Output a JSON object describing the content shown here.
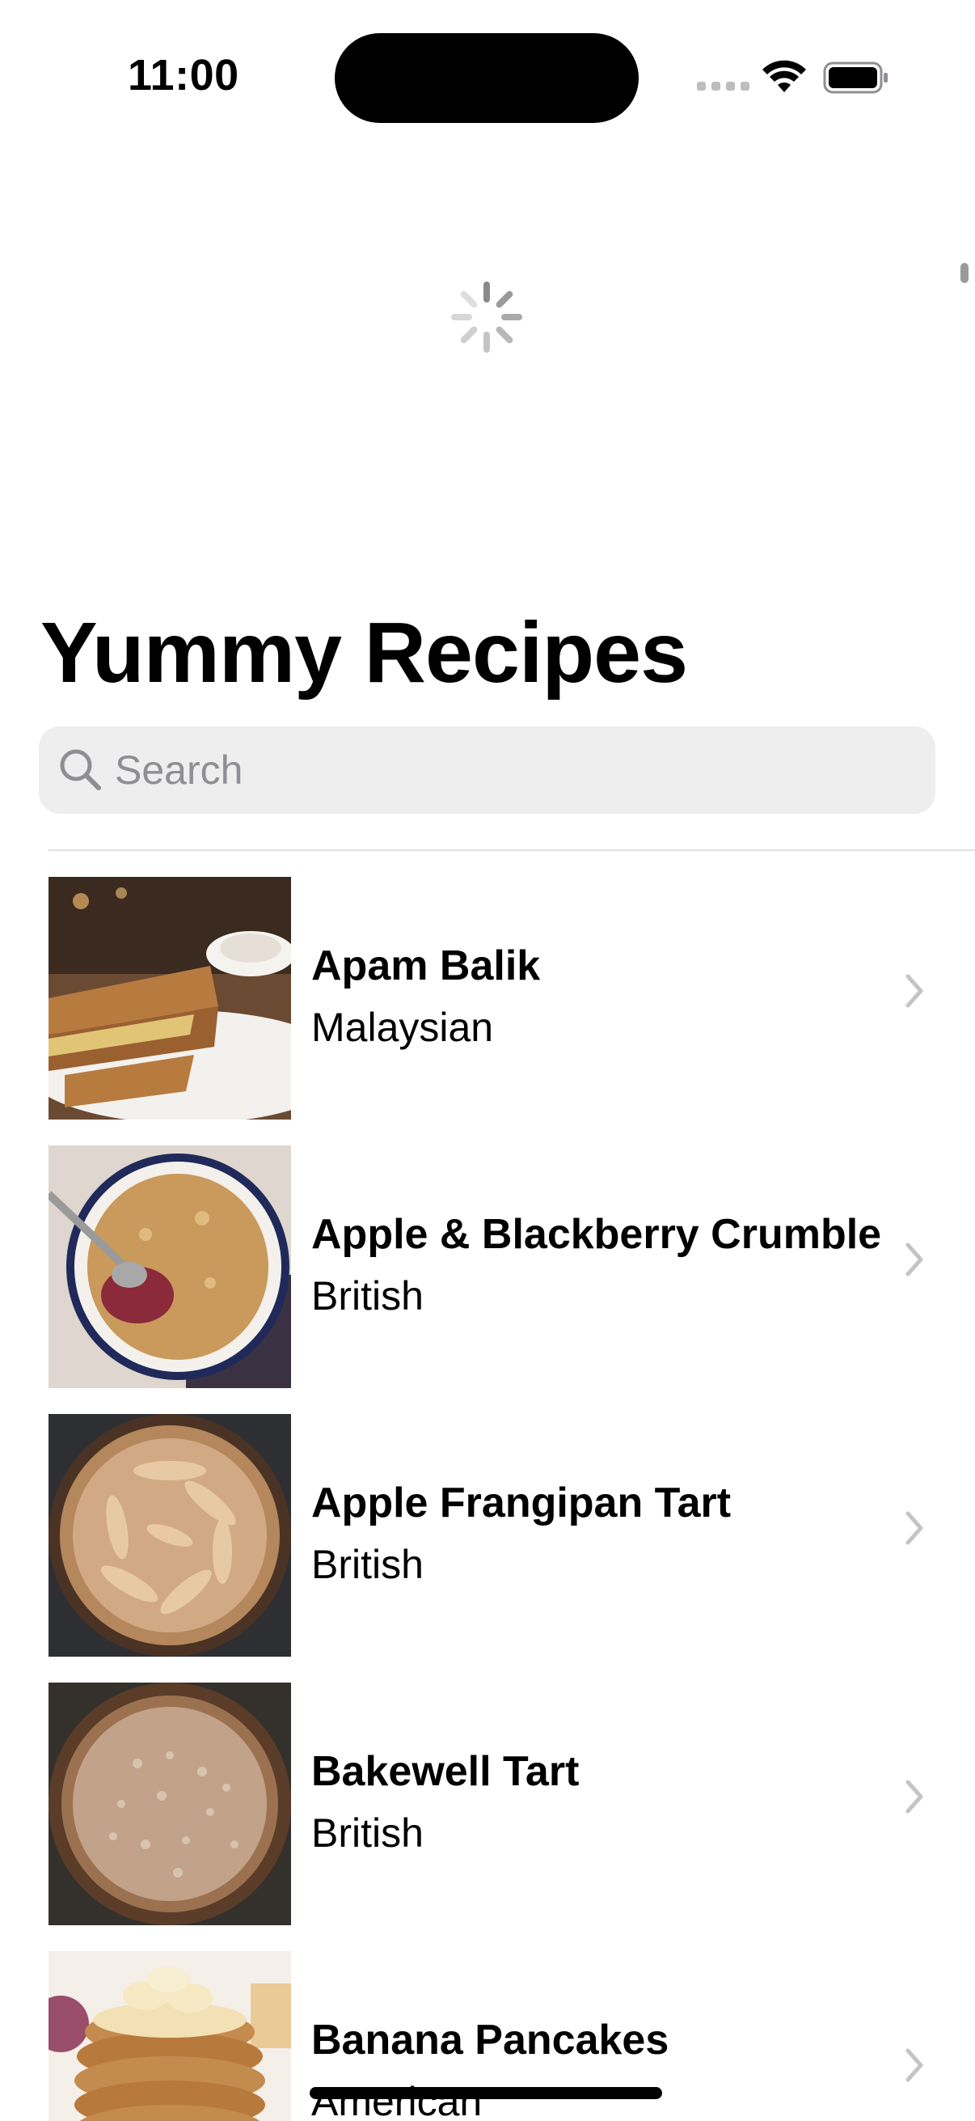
{
  "status_bar": {
    "time": "11:00",
    "icons": [
      "cellular-signal-icon",
      "wifi-icon",
      "battery-icon"
    ]
  },
  "loading_indicator": "activity-spinner-icon",
  "title": "Yummy Recipes",
  "search": {
    "placeholder": "Search",
    "value": "",
    "icon": "magnifying-glass-icon"
  },
  "recipes": [
    {
      "name": "Apam Balik",
      "cuisine": "Malaysian"
    },
    {
      "name": "Apple & Blackberry Crumble",
      "cuisine": "British"
    },
    {
      "name": "Apple Frangipan Tart",
      "cuisine": "British"
    },
    {
      "name": "Bakewell Tart",
      "cuisine": "British"
    },
    {
      "name": "Banana Pancakes",
      "cuisine": "American"
    }
  ],
  "colors": {
    "background": "#ffffff",
    "search_background": "#eeeeef",
    "placeholder": "#8e8e93",
    "chevron": "#c4c4c7"
  }
}
